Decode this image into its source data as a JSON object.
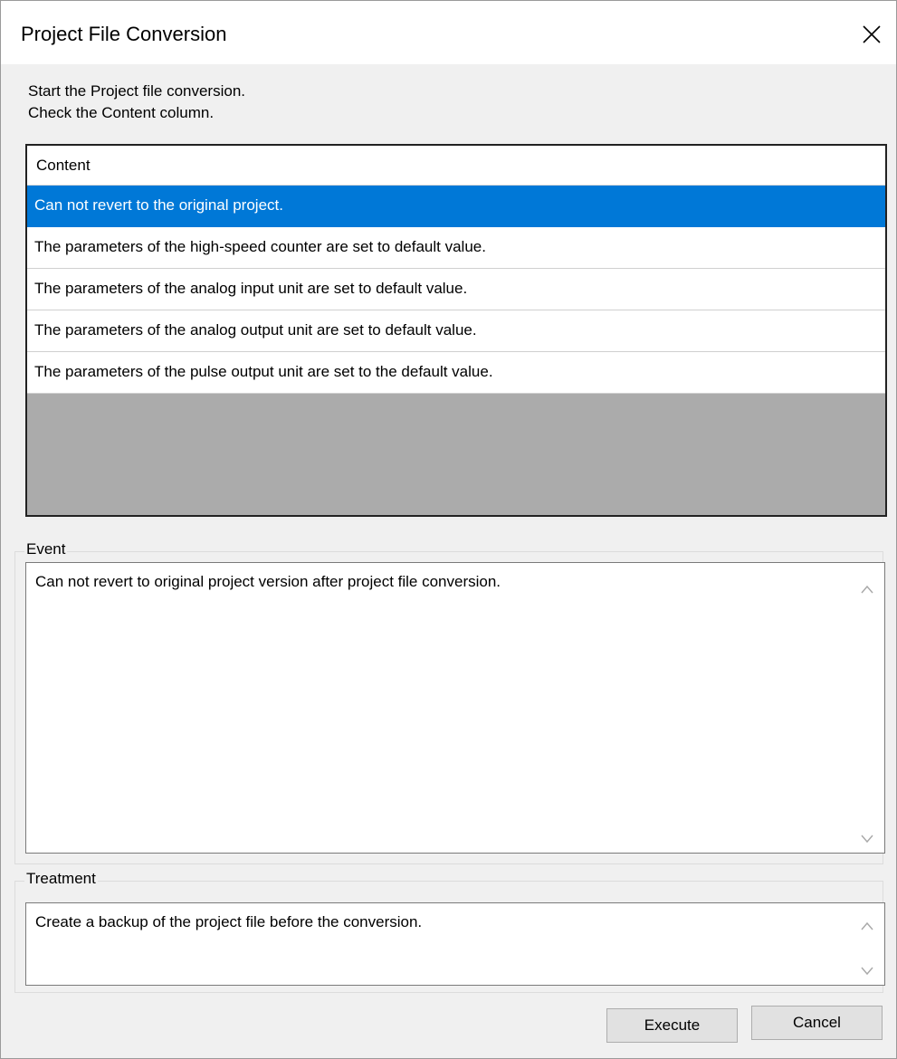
{
  "dialog": {
    "title": "Project File Conversion",
    "close_icon": "close-icon"
  },
  "intro": {
    "line1": "Start the Project file conversion.",
    "line2": "Check the Content column."
  },
  "list": {
    "header": "Content",
    "rows": [
      {
        "text": "Can not revert to the original project.",
        "selected": true
      },
      {
        "text": "The parameters of the high-speed counter are set to default value.",
        "selected": false
      },
      {
        "text": "The parameters of the analog input unit are set to default value.",
        "selected": false
      },
      {
        "text": "The parameters of the analog output unit are set to default value.",
        "selected": false
      },
      {
        "text": "The parameters of the pulse output unit are set to the default value.",
        "selected": false
      }
    ]
  },
  "event": {
    "label": "Event",
    "text": "Can not revert to original project version after project file conversion."
  },
  "treatment": {
    "label": "Treatment",
    "text": "Create a backup of the project file before the conversion."
  },
  "buttons": {
    "execute": "Execute",
    "cancel": "Cancel"
  },
  "colors": {
    "selection": "#0078d7",
    "list_empty_area": "#ababab",
    "dialog_bg": "#f0f0f0"
  }
}
